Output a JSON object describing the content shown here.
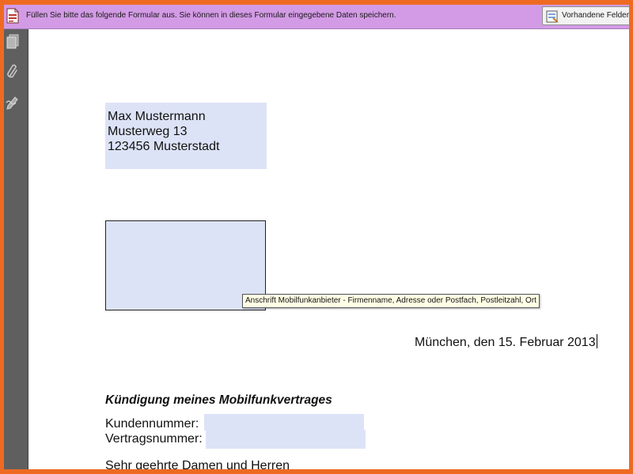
{
  "form_bar": {
    "message": "Füllen Sie bitte das folgende Formular aus. Sie können in dieses Formular eingegebene Daten speichern.",
    "fields_button_label": "Vorhandene Felder",
    "icon": "pdf-form-icon",
    "fields_icon": "highlight-fields-icon"
  },
  "left_panel": {
    "tools": [
      "pages-icon",
      "attachment-paperclip-icon",
      "signature-pen-icon"
    ]
  },
  "document": {
    "sender": {
      "name": "Max Mustermann",
      "street": "Musterweg 13",
      "city": "123456 Musterstadt"
    },
    "recipient_field": {
      "value": "",
      "tooltip": "Anschrift Mobilfunkanbieter - Firmenname, Adresse oder Postfach, Postleitzahl, Ort"
    },
    "date_line": "München, den 15. Februar 2013",
    "subject": "Kündigung meines Mobilfunkvertrages",
    "customer_number_label": "Kundennummer:",
    "customer_number_value": "",
    "contract_number_label": "Vertragsnummer:",
    "contract_number_value": "",
    "greeting": "Sehr geehrte Damen und Herren"
  },
  "colors": {
    "outer_border": "#ee6a22",
    "form_bar": "#d39be5",
    "field_fill": "#dde3f6",
    "left_panel": "#5f5f5f"
  }
}
